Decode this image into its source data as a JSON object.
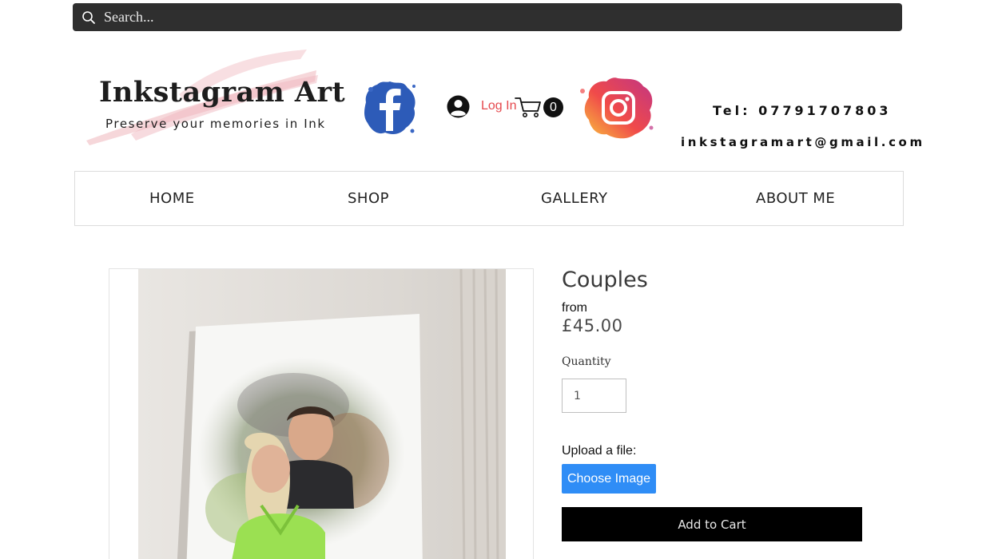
{
  "search": {
    "placeholder": "Search..."
  },
  "header": {
    "logo_title": "Inkstagram Art",
    "logo_subtitle": "Preserve your memories in Ink",
    "login_label": "Log In",
    "cart_count": "0",
    "tel": "Tel: 07791707803",
    "email": "inkstagramart@gmail.com"
  },
  "nav": {
    "items": [
      {
        "label": "HOME"
      },
      {
        "label": "SHOP"
      },
      {
        "label": "GALLERY"
      },
      {
        "label": "ABOUT ME"
      }
    ]
  },
  "product": {
    "title": "Couples",
    "from_label": "from",
    "price": "£45.00",
    "quantity_label": "Quantity",
    "quantity_value": "1",
    "upload_label": "Upload a file:",
    "choose_image_label": "Choose Image",
    "add_to_cart_label": "Add to Cart"
  },
  "icons": {
    "search": "search-icon",
    "facebook": "facebook-icon",
    "avatar": "avatar-icon",
    "cart": "cart-icon",
    "instagram": "instagram-icon"
  },
  "colors": {
    "search_bar": "#2f2f2f",
    "login_text": "#e5484d",
    "choose_button": "#2f8df6",
    "add_to_cart_button": "#000000",
    "facebook_blue": "#2d5bb8"
  }
}
